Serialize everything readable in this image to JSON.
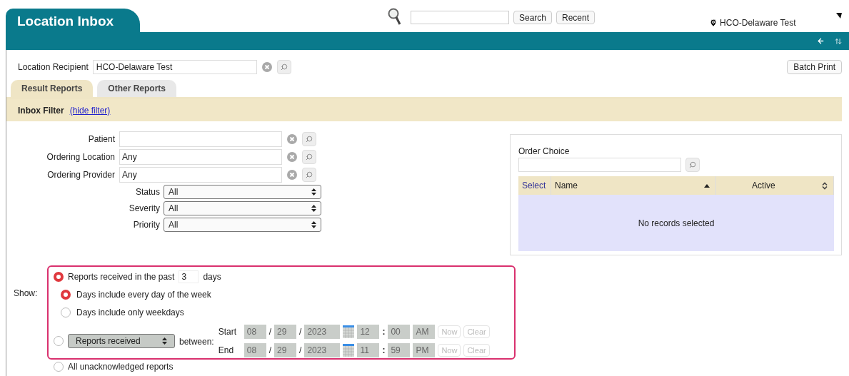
{
  "header": {
    "title": "Location Inbox",
    "search_button": "Search",
    "recent_button": "Recent",
    "location": "HCO-Delaware Test"
  },
  "recipient": {
    "label": "Location Recipient",
    "value": "HCO-Delaware Test",
    "batch_print": "Batch Print"
  },
  "tabs": [
    {
      "label": "Result Reports",
      "selected": true
    },
    {
      "label": "Other Reports",
      "selected": false
    }
  ],
  "filter_bar": {
    "title": "Inbox Filter",
    "link": "(hide filter)"
  },
  "filters": [
    {
      "kind": "lookup",
      "label": "Patient"
    },
    {
      "kind": "lookup",
      "label": "Ordering Location",
      "value": "Any"
    },
    {
      "kind": "lookup",
      "label": "Ordering Provider",
      "value": "Any"
    },
    {
      "kind": "select",
      "label": "Status",
      "value": "All"
    },
    {
      "kind": "select",
      "label": "Severity",
      "value": "All"
    },
    {
      "kind": "select",
      "label": "Priority",
      "value": "All"
    }
  ],
  "order_choice": {
    "label": "Order Choice",
    "select_header": "Select",
    "columns": [
      {
        "label": "Name",
        "sorted": true
      },
      {
        "label": "Active",
        "sorted": false
      }
    ],
    "empty_message": "No records selected"
  },
  "show": {
    "label": "Show:",
    "past": {
      "selected": true,
      "label": "Reports received in the past",
      "days": "3",
      "unit": "days",
      "options": [
        {
          "label": "Days include every day of the week",
          "selected": true
        },
        {
          "label": "Days include only weekdays",
          "selected": false
        }
      ]
    },
    "range": {
      "selected": false,
      "disabled": true,
      "select": "Reports received",
      "between": "between:",
      "separator_date": "/",
      "separator_time": ":",
      "rows": [
        {
          "label": "Start",
          "month": "08",
          "day": "29",
          "year": "2023",
          "hour": "12",
          "minute": "00",
          "ampm": "AM",
          "now": "Now",
          "clear": "Clear"
        },
        {
          "label": "End",
          "month": "08",
          "day": "29",
          "year": "2023",
          "hour": "11",
          "minute": "59",
          "ampm": "PM",
          "now": "Now",
          "clear": "Clear"
        }
      ]
    },
    "unacknowledged": {
      "selected": false,
      "label": "All unacknowledged reports"
    }
  }
}
